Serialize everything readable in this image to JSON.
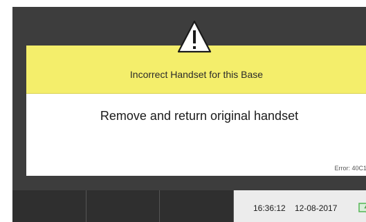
{
  "dialog": {
    "title": "Incorrect Handset for this Base",
    "message": "Remove and return original handset",
    "error_code": "Error: 40C1"
  },
  "status_bar": {
    "time": "16:36:12",
    "date": "12-08-2017"
  },
  "icons": {
    "warning": "warning-triangle-icon",
    "battery": "battery-charging-icon"
  },
  "colors": {
    "screen_background": "#3d3d3d",
    "dialog_header": "#f4ee6b",
    "dialog_body": "#ffffff",
    "taskbar_button": "#2f2f2f",
    "status_area": "#ececec",
    "battery_accent": "#5cb85c"
  }
}
